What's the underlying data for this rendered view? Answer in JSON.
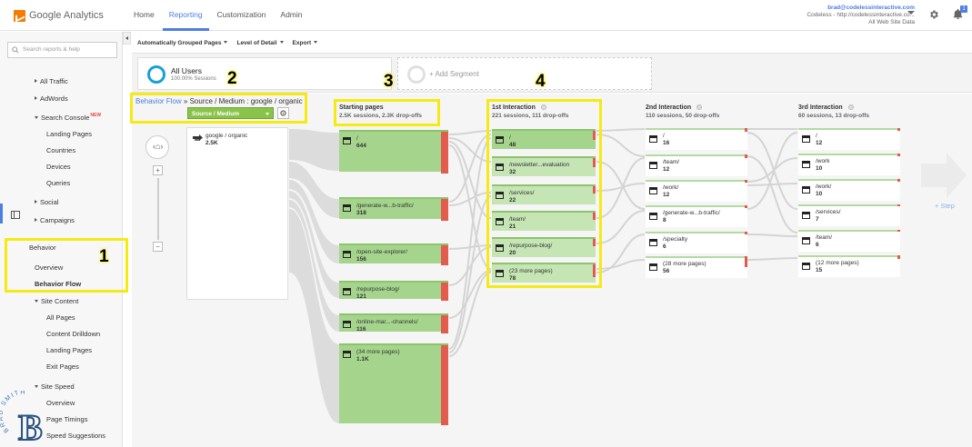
{
  "app": {
    "logo_text": "Google Analytics"
  },
  "nav": [
    {
      "label": "Home"
    },
    {
      "label": "Reporting",
      "active": true
    },
    {
      "label": "Customization"
    },
    {
      "label": "Admin"
    }
  ],
  "account": {
    "email": "brad@codelessinteractive.com",
    "property": "Codeless - http://codelessinteractive.co...",
    "view": "All Web Site Data",
    "notification_count": "1"
  },
  "sidebar": {
    "search_placeholder": "Search reports & help",
    "items": [
      {
        "label": "All Traffic",
        "level": 1
      },
      {
        "label": "AdWords",
        "level": 1
      },
      {
        "label": "Search Console",
        "level": 1,
        "badge": "NEW",
        "expanded": true
      },
      {
        "label": "Landing Pages",
        "level": 2
      },
      {
        "label": "Countries",
        "level": 2
      },
      {
        "label": "Devices",
        "level": 2
      },
      {
        "label": "Queries",
        "level": 2
      },
      {
        "label": "Social",
        "level": 1
      },
      {
        "label": "Campaigns",
        "level": 1
      },
      {
        "label": "Behavior",
        "level": 0
      },
      {
        "label": "Overview",
        "level": 1
      },
      {
        "label": "Behavior Flow",
        "level": 1,
        "selected": true
      },
      {
        "label": "Site Content",
        "level": 1,
        "expanded": true
      },
      {
        "label": "All Pages",
        "level": 2
      },
      {
        "label": "Content Drilldown",
        "level": 2
      },
      {
        "label": "Landing Pages",
        "level": 2
      },
      {
        "label": "Exit Pages",
        "level": 2
      },
      {
        "label": "Site Speed",
        "level": 1,
        "expanded": true
      },
      {
        "label": "Overview",
        "level": 2
      },
      {
        "label": "Page Timings",
        "level": 2
      },
      {
        "label": "Speed Suggestions",
        "level": 2
      }
    ]
  },
  "toolbar": {
    "grouped": "Automatically Grouped Pages",
    "detail": "Level of Detail",
    "export": "Export"
  },
  "segments": {
    "active_name": "All Users",
    "active_sub": "100.00% Sessions",
    "add_label": "+ Add Segment",
    "ring_color": "#1a9fd9"
  },
  "flow": {
    "breadcrumb_link": "Behavior Flow",
    "breadcrumb_rest": " » Source / Medium : google / organic",
    "dimension": "Source / Medium",
    "source": {
      "label": "google / organic",
      "count": "2.5K"
    },
    "step_link": "+ Step",
    "columns": [
      {
        "title": "Starting pages",
        "sub": "2.5K sessions, 2.3K drop-offs"
      },
      {
        "title": "1st Interaction",
        "sub": "221 sessions, 111 drop-offs"
      },
      {
        "title": "2nd Interaction",
        "sub": "110 sessions, 50 drop-offs"
      },
      {
        "title": "3rd Interaction",
        "sub": "60 sessions, 13 drop-offs"
      }
    ],
    "starting": [
      {
        "label": "/",
        "count": "644"
      },
      {
        "label": "/generate-w...b-traffic/",
        "count": "318"
      },
      {
        "label": "/open-site-explorer/",
        "count": "156"
      },
      {
        "label": "/repurpose-blog/",
        "count": "121"
      },
      {
        "label": "/online-mar...-channels/",
        "count": "116"
      },
      {
        "label": "(34 more pages)",
        "count": "1.1K"
      }
    ],
    "first": [
      {
        "label": "/",
        "count": "48"
      },
      {
        "label": "/newsletter...evaluation",
        "count": "32"
      },
      {
        "label": "/services/",
        "count": "22"
      },
      {
        "label": "/team/",
        "count": "21"
      },
      {
        "label": "/repurpose-blog/",
        "count": "20"
      },
      {
        "label": "(23 more pages)",
        "count": "78"
      }
    ],
    "second": [
      {
        "label": "/",
        "count": "16"
      },
      {
        "label": "/team/",
        "count": "12"
      },
      {
        "label": "/work/",
        "count": "12"
      },
      {
        "label": "/generate-w...b-traffic/",
        "count": "8"
      },
      {
        "label": "/specialty",
        "count": "6"
      },
      {
        "label": "(28 more pages)",
        "count": "56"
      }
    ],
    "third": [
      {
        "label": "/",
        "count": "12"
      },
      {
        "label": "/work",
        "count": "10"
      },
      {
        "label": "/work/",
        "count": "10"
      },
      {
        "label": "/services/",
        "count": "7"
      },
      {
        "label": "/team/",
        "count": "6"
      },
      {
        "label": "(12 more pages)",
        "count": "15"
      }
    ]
  },
  "annotations": [
    {
      "number": "1"
    },
    {
      "number": "2"
    },
    {
      "number": "3"
    },
    {
      "number": "4"
    }
  ],
  "watermark": {
    "text": "BRAD SMITH",
    "letter": "B"
  },
  "colors": {
    "accent": "#4d7ee0",
    "node_green": "#a5d58d",
    "dropoff_red": "#e35b4f",
    "annotation_yellow": "#f5ea14"
  }
}
